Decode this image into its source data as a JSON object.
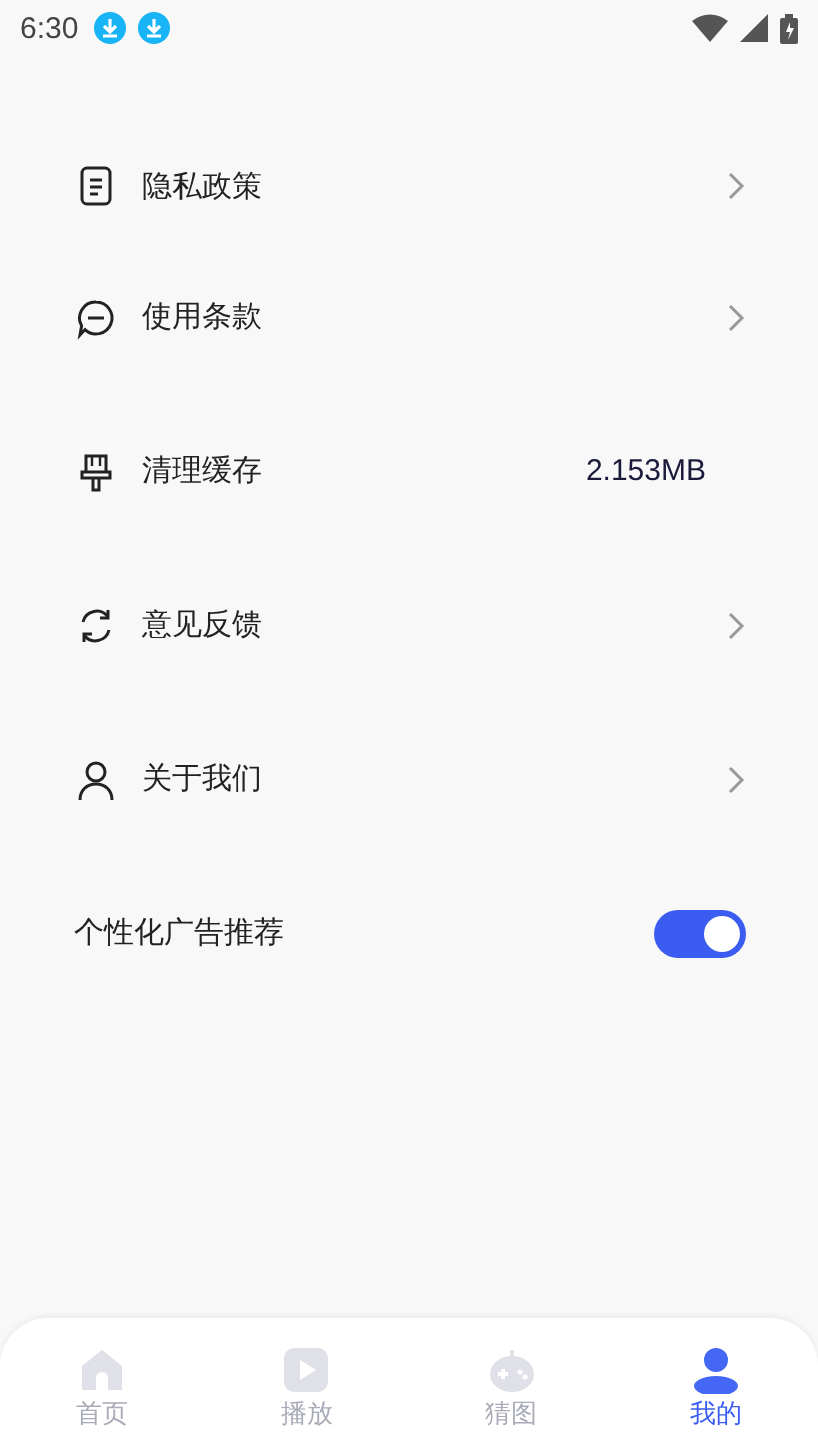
{
  "status_bar": {
    "time": "6:30"
  },
  "settings": [
    {
      "kind": "link",
      "label": "隐私政策"
    },
    {
      "kind": "link",
      "label": "使用条款"
    },
    {
      "kind": "value",
      "label": "清理缓存",
      "value": "2.153MB"
    },
    {
      "kind": "link",
      "label": "意见反馈"
    },
    {
      "kind": "link",
      "label": "关于我们"
    },
    {
      "kind": "toggle",
      "label": "个性化广告推荐",
      "on": true
    }
  ],
  "nav": [
    {
      "label": "首页",
      "selected": false
    },
    {
      "label": "播放",
      "selected": false
    },
    {
      "label": "猜图",
      "selected": false
    },
    {
      "label": "我的",
      "selected": true
    }
  ]
}
